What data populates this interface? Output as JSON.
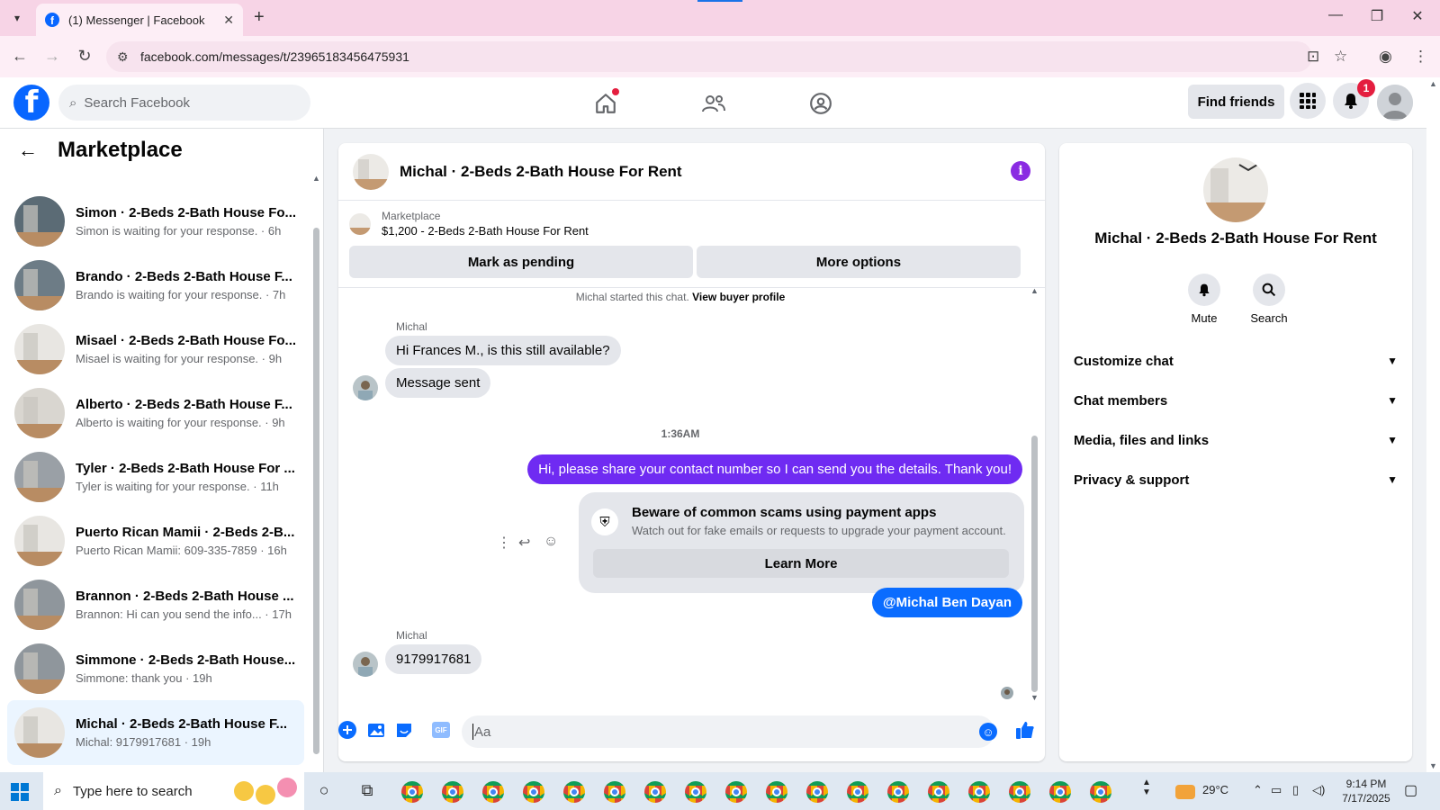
{
  "browser": {
    "tab_title": "(1) Messenger | Facebook",
    "url": "facebook.com/messages/t/23965183456475931"
  },
  "facebook": {
    "search_placeholder": "Search Facebook",
    "find_friends": "Find friends",
    "notification_count": "1"
  },
  "sidebar": {
    "title": "Marketplace",
    "conversations": [
      {
        "name": "Simon · 2-Beds 2-Bath House Fo...",
        "preview": "Simon is waiting for your response. · 6h"
      },
      {
        "name": "Brando · 2-Beds 2-Bath House F...",
        "preview": "Brando is waiting for your response. · 7h"
      },
      {
        "name": "Misael · 2-Beds 2-Bath House Fo...",
        "preview": "Misael is waiting for your response. · 9h"
      },
      {
        "name": "Alberto · 2-Beds 2-Bath House F...",
        "preview": "Alberto is waiting for your response. · 9h"
      },
      {
        "name": "Tyler · 2-Beds 2-Bath House For ...",
        "preview": "Tyler is waiting for your response. · 11h"
      },
      {
        "name": "Puerto Rican Mamii · 2-Beds 2-B...",
        "preview": "Puerto Rican Mamii: 609-335-7859 · 16h"
      },
      {
        "name": "Brannon · 2-Beds 2-Bath House ...",
        "preview": "Brannon: Hi can you send the info... · 17h"
      },
      {
        "name": "Simmone · 2-Beds 2-Bath House...",
        "preview": "Simmone: thank you · 19h"
      },
      {
        "name": "Michal · 2-Beds 2-Bath House F...",
        "preview": "Michal: 9179917681 · 19h"
      }
    ]
  },
  "chat": {
    "title": "Michal · 2-Beds 2-Bath House For Rent",
    "listing_label": "Marketplace",
    "listing_detail": "$1,200 - 2-Beds 2-Bath House For Rent",
    "mark_pending": "Mark as pending",
    "more_options": "More options",
    "system_text": "Michal started this chat.",
    "view_buyer_profile": "View buyer profile",
    "sender_1": "Michal",
    "msg_1": "Hi Frances M., is this still available?",
    "msg_2": "Message sent",
    "timestamp": "1:36AM",
    "msg_out_1": "Hi, please share your contact number so I can send you the details. Thank you!",
    "scam_title": "Beware of common scams using payment apps",
    "scam_sub": "Watch out for fake emails or requests to upgrade your payment account.",
    "learn_more": "Learn More",
    "msg_out_2": "@Michal Ben Dayan",
    "sender_2": "Michal",
    "msg_3": "9179917681",
    "composer_placeholder": "Aa"
  },
  "details": {
    "name": "Michal · 2-Beds 2-Bath House For Rent",
    "mute": "Mute",
    "search": "Search",
    "sections": [
      "Customize chat",
      "Chat members",
      "Media, files and links",
      "Privacy & support"
    ]
  },
  "taskbar": {
    "search_placeholder": "Type here to search",
    "weather": "29°C",
    "time": "9:14 PM",
    "date": "7/17/2025"
  }
}
